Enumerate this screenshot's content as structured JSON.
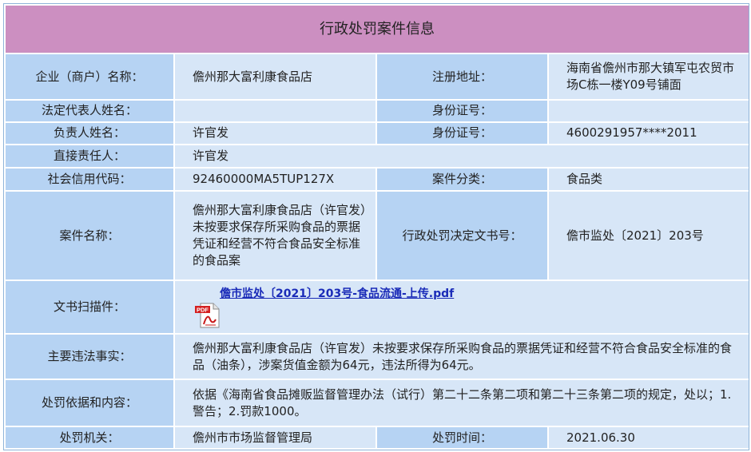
{
  "title": "行政处罚案件信息",
  "rows": {
    "enterprise_name_label": "企业（商户）名称：",
    "enterprise_name": "儋州那大富利康食品店",
    "address_label": "注册地址：",
    "address": "海南省儋州市那大镇军屯农贸市场C栋一楼Y09号铺面",
    "legal_rep_label": "法定代表人姓名：",
    "legal_rep": "",
    "legal_id_label": "身份证号：",
    "legal_id": "",
    "manager_label": "负责人姓名：",
    "manager": "许官发",
    "manager_id_label": "身份证号：",
    "manager_id": "4600291957****2011",
    "responsible_label": "直接责任人：",
    "responsible": "许官发",
    "credit_code_label": "社会信用代码：",
    "credit_code": "92460000MA5TUP127X",
    "case_category_label": "案件分类：",
    "case_category": "食品类",
    "case_name_label": "案件名称：",
    "case_name": "儋州那大富利康食品店（许官发）未按要求保存所采购食品的票据凭证和经营不符合食品安全标准的食品案",
    "decision_no_label": "行政处罚决定文书号：",
    "decision_no": "儋市监处〔2021〕203号",
    "scan_label": "文书扫描件：",
    "scan_link": "儋市监处〔2021〕203号-食品流通-上传.pdf",
    "facts_label": "主要违法事实：",
    "facts": "儋州那大富利康食品店（许官发）未按要求保存所采购食品的票据凭证和经营不符合食品安全标准的食品（油条），涉案货值金额为64元，违法所得为64元。",
    "basis_label": "处罚依据和内容：",
    "basis": "依据《海南省食品摊贩监督管理办法（试行）第二十二条第二项和第二十三条第二项的规定，处以；1.警告；2.罚款1000。",
    "authority_label": "处罚机关：",
    "authority": "儋州市市场监督管理局",
    "date_label": "处罚时间：",
    "date": "2021.06.30"
  },
  "icons": {
    "pdf": "pdf-file-icon"
  },
  "colors": {
    "title_bg": "#cc8fc1",
    "label_bg": "#b6d3f3",
    "value_bg": "#d7e6f7",
    "link": "#1a2bb8"
  }
}
